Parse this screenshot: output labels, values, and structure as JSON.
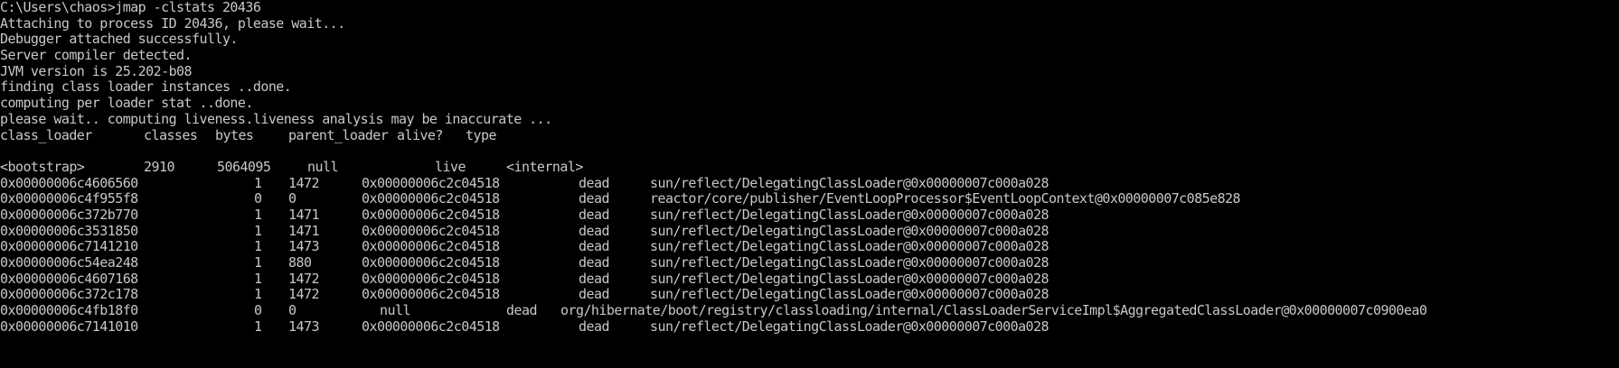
{
  "window": {
    "background": "#000000",
    "text_color": "#c8c8c8"
  },
  "intro_lines": [
    "C:\\Users\\chaos>jmap -clstats 20436",
    "Attaching to process ID 20436, please wait...",
    "Debugger attached successfully.",
    "Server compiler detected.",
    "JVM version is 25.202-b08",
    "finding class loader instances ..done.",
    "computing per loader stat ..done.",
    "please wait.. computing liveness.liveness analysis may be inaccurate ..."
  ],
  "header": {
    "class_loader": "class_loader",
    "classes": "classes",
    "bytes": "bytes",
    "parent_loader": "parent_loader",
    "alive": "alive?",
    "type": "type"
  },
  "bootstrap_row": {
    "class_loader": "<bootstrap>",
    "classes": "2910",
    "bytes": "5064095",
    "parent_loader": "null",
    "alive": "live",
    "type": "<internal>"
  },
  "rows": [
    {
      "class_loader": "0x00000006c4606560",
      "classes": "1",
      "bytes": "1472",
      "parent_loader": "0x00000006c2c04518",
      "alive": "dead",
      "type": "sun/reflect/DelegatingClassLoader@0x00000007c000a028"
    },
    {
      "class_loader": "0x00000006c4f955f8",
      "classes": "0",
      "bytes": "0",
      "parent_loader": "0x00000006c2c04518",
      "alive": "dead",
      "type": "reactor/core/publisher/EventLoopProcessor$EventLoopContext@0x00000007c085e828"
    },
    {
      "class_loader": "0x00000006c372b770",
      "classes": "1",
      "bytes": "1471",
      "parent_loader": "0x00000006c2c04518",
      "alive": "dead",
      "type": "sun/reflect/DelegatingClassLoader@0x00000007c000a028"
    },
    {
      "class_loader": "0x00000006c3531850",
      "classes": "1",
      "bytes": "1471",
      "parent_loader": "0x00000006c2c04518",
      "alive": "dead",
      "type": "sun/reflect/DelegatingClassLoader@0x00000007c000a028"
    },
    {
      "class_loader": "0x00000006c7141210",
      "classes": "1",
      "bytes": "1473",
      "parent_loader": "0x00000006c2c04518",
      "alive": "dead",
      "type": "sun/reflect/DelegatingClassLoader@0x00000007c000a028"
    },
    {
      "class_loader": "0x00000006c54ea248",
      "classes": "1",
      "bytes": "880",
      "parent_loader": "0x00000006c2c04518",
      "alive": "dead",
      "type": "sun/reflect/DelegatingClassLoader@0x00000007c000a028"
    },
    {
      "class_loader": "0x00000006c4607168",
      "classes": "1",
      "bytes": "1472",
      "parent_loader": "0x00000006c2c04518",
      "alive": "dead",
      "type": "sun/reflect/DelegatingClassLoader@0x00000007c000a028"
    },
    {
      "class_loader": "0x00000006c372c178",
      "classes": "1",
      "bytes": "1472",
      "parent_loader": "0x00000006c2c04518",
      "alive": "dead",
      "type": "sun/reflect/DelegatingClassLoader@0x00000007c000a028"
    }
  ],
  "null_parent_row": {
    "class_loader": "0x00000006c4fb18f0",
    "classes": "0",
    "bytes": "0",
    "parent_loader": "null",
    "alive": "dead",
    "type": "org/hibernate/boot/registry/classloading/internal/ClassLoaderServiceImpl$AggregatedClassLoader@0x00000007c0900ea0"
  },
  "partial_row": {
    "class_loader": "0x00000006c7141010",
    "classes": "1",
    "bytes": "1473",
    "parent_loader": "0x00000006c2c04518",
    "alive": "dead",
    "type": "sun/reflect/DelegatingClassLoader@0x00000007c000a028"
  }
}
